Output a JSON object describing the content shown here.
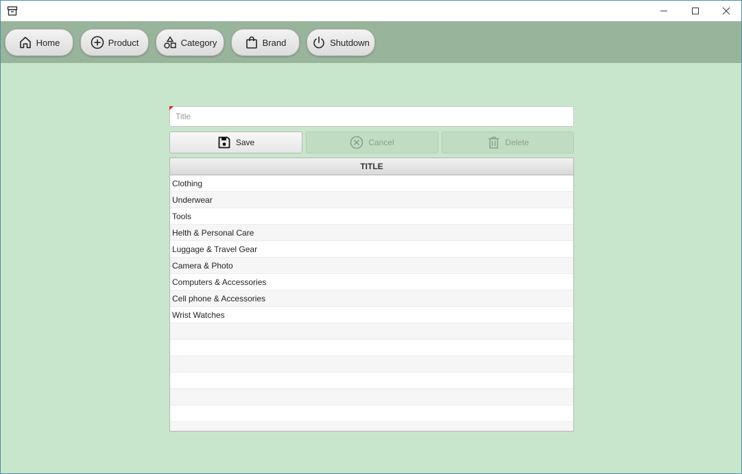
{
  "window": {
    "icons": {
      "app": "archive-icon",
      "minimize": "minimize-icon",
      "maximize": "maximize-icon",
      "close": "close-icon"
    }
  },
  "toolbar": {
    "home_label": "Home",
    "product_label": "Product",
    "category_label": "Category",
    "brand_label": "Brand",
    "shutdown_label": "Shutdown"
  },
  "form": {
    "title_placeholder": "Title",
    "title_value": ""
  },
  "actions": {
    "save_label": "Save",
    "cancel_label": "Cancel",
    "delete_label": "Delete"
  },
  "table": {
    "header": "TITLE",
    "rows": [
      "Clothing",
      "Underwear",
      "Tools",
      "Helth & Personal Care",
      "Luggage & Travel Gear",
      "Camera & Photo",
      "Computers & Accessories",
      "Cell phone & Accessories",
      "Wrist Watches"
    ]
  },
  "colors": {
    "background": "#c8e6cb",
    "toolbar": "#98b49a",
    "disabled_button": "#c0dcc3"
  }
}
